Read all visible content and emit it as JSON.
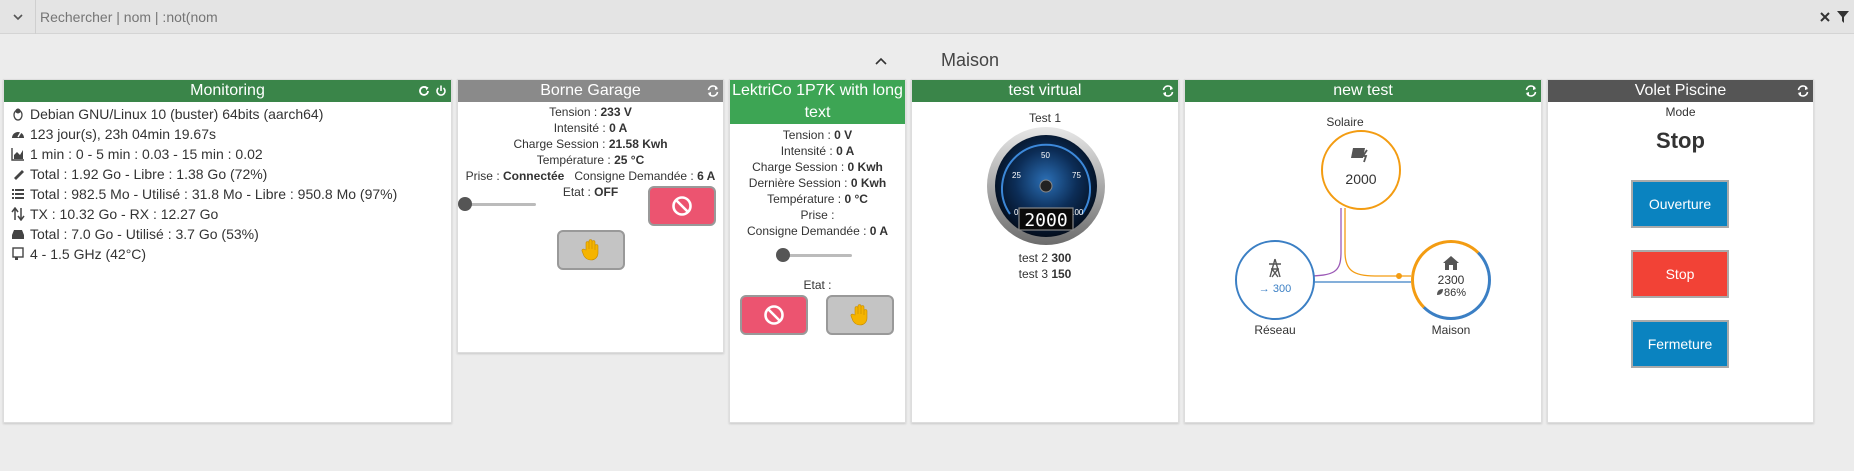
{
  "search": {
    "placeholder": "Rechercher | nom | :not(nom"
  },
  "section": {
    "title": "Maison"
  },
  "monitoring": {
    "title": "Monitoring",
    "rows": [
      {
        "icon": "linux-icon",
        "text": "Debian GNU/Linux 10 (buster) 64bits (aarch64)"
      },
      {
        "icon": "dashboard-icon",
        "text": "123 jour(s), 23h 04min 19.67s"
      },
      {
        "icon": "chart-area-icon",
        "text": "1 min : 0 - 5 min : 0.03 - 15 min : 0.02"
      },
      {
        "icon": "memory-icon",
        "text": "Total : 1.92 Go - Libre : 1.38 Go (72%)"
      },
      {
        "icon": "list-icon",
        "text": "Total : 982.5 Mo - Utilisé : 31.8 Mo - Libre : 950.8 Mo (97%)"
      },
      {
        "icon": "network-arrows-icon",
        "text": "TX : 10.32 Go - RX : 12.27 Go"
      },
      {
        "icon": "hdd-icon",
        "text": "Total : 7.0 Go - Utilisé : 3.7 Go (53%)"
      },
      {
        "icon": "cpu-icon",
        "text": "4 - 1.5 GHz (42°C)"
      }
    ]
  },
  "borne": {
    "title": "Borne Garage",
    "tension": {
      "label": "Tension : ",
      "value": "233 V"
    },
    "intensite": {
      "label": "Intensité : ",
      "value": "0 A"
    },
    "charge": {
      "label": "Charge Session : ",
      "value": "21.58 Kwh"
    },
    "temperature": {
      "label": "Température : ",
      "value": "25 °C"
    },
    "prise": {
      "label": "Prise : ",
      "value": "Connectée"
    },
    "consigne": {
      "label": "Consigne Demandée : ",
      "value": "6 A"
    },
    "etat": {
      "label": "Etat : ",
      "value": "OFF"
    }
  },
  "lektrico": {
    "title": "LektriCo 1P7K with long text",
    "tension": {
      "label": "Tension : ",
      "value": "0 V"
    },
    "intensite": {
      "label": "Intensité : ",
      "value": "0 A"
    },
    "charge": {
      "label": "Charge Session : ",
      "value": "0 Kwh"
    },
    "derniere": {
      "label": "Dernière Session : ",
      "value": "0 Kwh"
    },
    "temperature": {
      "label": "Température : ",
      "value": "0 °C"
    },
    "prise": {
      "label": "Prise :",
      "value": ""
    },
    "consigne": {
      "label": "Consigne Demandée : ",
      "value": "0 A"
    },
    "etat": {
      "label": "Etat :",
      "value": ""
    }
  },
  "virtual": {
    "title": "test virtual",
    "gauge_label": "Test 1",
    "gauge_value": "2000",
    "gauge_ticks": [
      "0",
      "25",
      "50",
      "75",
      "100"
    ],
    "test2": {
      "label": "test 2 ",
      "value": "300"
    },
    "test3": {
      "label": "test 3 ",
      "value": "150"
    }
  },
  "newtest": {
    "title": "new test",
    "solar_label": "Solaire",
    "solar_value": "2000",
    "grid_label": "Réseau",
    "grid_value": "→ 300",
    "home_label": "Maison",
    "home_value": "2300",
    "home_pct": "86%"
  },
  "volet": {
    "title": "Volet Piscine",
    "mode_label": "Mode",
    "mode_value": "Stop",
    "open": "Ouverture",
    "stop": "Stop",
    "close": "Fermeture"
  },
  "colors": {
    "header_green": "#3a8549",
    "header_grey": "#8a8a8a",
    "header_dark": "#555555",
    "header_bright_green": "#3da554",
    "button_blue": "#0a83c0",
    "button_red": "#f24236",
    "button_pink": "#ec5470",
    "solar_orange": "#f39c12",
    "grid_blue": "#3b7fc4"
  }
}
